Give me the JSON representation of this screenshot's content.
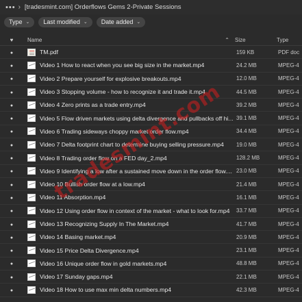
{
  "titlebar": {
    "menu_icon": "more-dots-icon",
    "chevron_icon": "chevron-right-icon",
    "title": "[tradesmint.com] Orderflows Gems 2-Private Sessions"
  },
  "filters": [
    {
      "label": "Type"
    },
    {
      "label": "Last modified"
    },
    {
      "label": "Date added"
    }
  ],
  "table": {
    "headers": {
      "pin": "♥",
      "name": "Name",
      "sort_indicator": "⌃",
      "size": "Size",
      "type": "Type"
    },
    "rows": [
      {
        "name": "TM.pdf",
        "size": "159 KB",
        "type": "PDF doc",
        "icon": "pdf"
      },
      {
        "name": "Video 1 How to react when you see big size in the market.mp4",
        "size": "24.2 MB",
        "type": "MPEG-4",
        "icon": "video"
      },
      {
        "name": "Video 2 Prepare yourself for explosive breakouts.mp4",
        "size": "12.0 MB",
        "type": "MPEG-4",
        "icon": "video"
      },
      {
        "name": "Video 3 Stopping volume - how to recognize it and trade it.mp4",
        "size": "44.5 MB",
        "type": "MPEG-4",
        "icon": "video"
      },
      {
        "name": "Video 4 Zero prints as a trade entry.mp4",
        "size": "39.2 MB",
        "type": "MPEG-4",
        "icon": "video"
      },
      {
        "name": "Video 5 Flow driven markets using delta divergence and pullbacks off hi...",
        "size": "39.1 MB",
        "type": "MPEG-4",
        "icon": "video"
      },
      {
        "name": "Video 6 Trading sideways choppy market order flow.mp4",
        "size": "34.4 MB",
        "type": "MPEG-4",
        "icon": "video"
      },
      {
        "name": "Video 7 Delta footprint chart to determine buying selling pressure.mp4",
        "size": "19.0 MB",
        "type": "MPEG-4",
        "icon": "video"
      },
      {
        "name": "Video 8 Trading order flow on a FED day_2.mp4",
        "size": "128.2 MB",
        "type": "MPEG-4",
        "icon": "video"
      },
      {
        "name": "Video 9 Identifying a low after a sustained move down in the order flow....",
        "size": "23.0 MB",
        "type": "MPEG-4",
        "icon": "video"
      },
      {
        "name": "Video 10 Bullish order flow at a low.mp4",
        "size": "21.4 MB",
        "type": "MPEG-4",
        "icon": "video"
      },
      {
        "name": "Video 11 Absorption.mp4",
        "size": "16.1 MB",
        "type": "MPEG-4",
        "icon": "video"
      },
      {
        "name": "Video 12 Using order flow in context of the market - what to look for.mp4",
        "size": "33.7 MB",
        "type": "MPEG-4",
        "icon": "video"
      },
      {
        "name": "Video 13 Recognizing Supply In The Market.mp4",
        "size": "41.7 MB",
        "type": "MPEG-4",
        "icon": "video"
      },
      {
        "name": "Video 14 Basing market.mp4",
        "size": "20.9 MB",
        "type": "MPEG-4",
        "icon": "video"
      },
      {
        "name": "Video 15 Price Delta Divergence.mp4",
        "size": "23.1 MB",
        "type": "MPEG-4",
        "icon": "video"
      },
      {
        "name": "Video 16 Unique order flow in gold markets.mp4",
        "size": "48.8 MB",
        "type": "MPEG-4",
        "icon": "video"
      },
      {
        "name": "Video 17 Sunday gaps.mp4",
        "size": "22.1 MB",
        "type": "MPEG-4",
        "icon": "video"
      },
      {
        "name": "Video 18 How to use max min delta numbers.mp4",
        "size": "42.3 MB",
        "type": "MPEG-4",
        "icon": "video"
      }
    ]
  },
  "watermark": {
    "text": "tradesmint.com"
  },
  "colors": {
    "background": "#2b2b2b",
    "chip": "#444444",
    "watermark": "#d21e1e"
  }
}
